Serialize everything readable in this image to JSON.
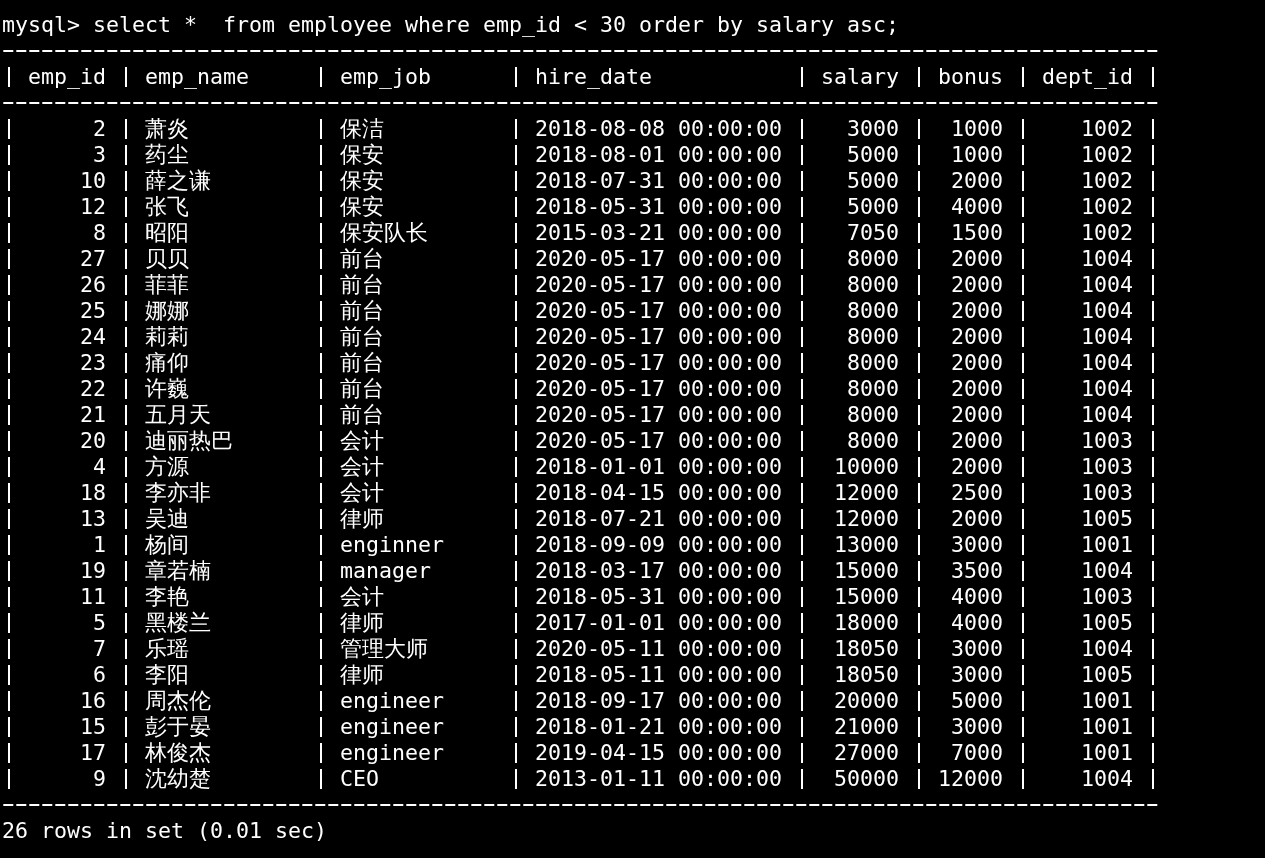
{
  "command": "mysql> select *  from employee where emp_id < 30 order by salary asc;",
  "table": {
    "columns": [
      {
        "label": "emp_id",
        "kind": "number"
      },
      {
        "label": "emp_name",
        "kind": "text"
      },
      {
        "label": "emp_job",
        "kind": "text"
      },
      {
        "label": "hire_date",
        "kind": "text"
      },
      {
        "label": "salary",
        "kind": "number"
      },
      {
        "label": "bonus",
        "kind": "number"
      },
      {
        "label": "dept_id",
        "kind": "number"
      }
    ],
    "rows": [
      [
        "2",
        "萧炎",
        "保洁",
        "2018-08-08 00:00:00",
        "3000",
        "1000",
        "1002"
      ],
      [
        "3",
        "药尘",
        "保安",
        "2018-08-01 00:00:00",
        "5000",
        "1000",
        "1002"
      ],
      [
        "10",
        "薛之谦",
        "保安",
        "2018-07-31 00:00:00",
        "5000",
        "2000",
        "1002"
      ],
      [
        "12",
        "张飞",
        "保安",
        "2018-05-31 00:00:00",
        "5000",
        "4000",
        "1002"
      ],
      [
        "8",
        "昭阳",
        "保安队长",
        "2015-03-21 00:00:00",
        "7050",
        "1500",
        "1002"
      ],
      [
        "27",
        "贝贝",
        "前台",
        "2020-05-17 00:00:00",
        "8000",
        "2000",
        "1004"
      ],
      [
        "26",
        "菲菲",
        "前台",
        "2020-05-17 00:00:00",
        "8000",
        "2000",
        "1004"
      ],
      [
        "25",
        "娜娜",
        "前台",
        "2020-05-17 00:00:00",
        "8000",
        "2000",
        "1004"
      ],
      [
        "24",
        "莉莉",
        "前台",
        "2020-05-17 00:00:00",
        "8000",
        "2000",
        "1004"
      ],
      [
        "23",
        "痛仰",
        "前台",
        "2020-05-17 00:00:00",
        "8000",
        "2000",
        "1004"
      ],
      [
        "22",
        "许巍",
        "前台",
        "2020-05-17 00:00:00",
        "8000",
        "2000",
        "1004"
      ],
      [
        "21",
        "五月天",
        "前台",
        "2020-05-17 00:00:00",
        "8000",
        "2000",
        "1004"
      ],
      [
        "20",
        "迪丽热巴",
        "会计",
        "2020-05-17 00:00:00",
        "8000",
        "2000",
        "1003"
      ],
      [
        "4",
        "方源",
        "会计",
        "2018-01-01 00:00:00",
        "10000",
        "2000",
        "1003"
      ],
      [
        "18",
        "李亦非",
        "会计",
        "2018-04-15 00:00:00",
        "12000",
        "2500",
        "1003"
      ],
      [
        "13",
        "吴迪",
        "律师",
        "2018-07-21 00:00:00",
        "12000",
        "2000",
        "1005"
      ],
      [
        "1",
        "杨间",
        "enginner",
        "2018-09-09 00:00:00",
        "13000",
        "3000",
        "1001"
      ],
      [
        "19",
        "章若楠",
        "manager",
        "2018-03-17 00:00:00",
        "15000",
        "3500",
        "1004"
      ],
      [
        "11",
        "李艳",
        "会计",
        "2018-05-31 00:00:00",
        "15000",
        "4000",
        "1003"
      ],
      [
        "5",
        "黑楼兰",
        "律师",
        "2017-01-01 00:00:00",
        "18000",
        "4000",
        "1005"
      ],
      [
        "7",
        "乐瑶",
        "管理大师",
        "2020-05-11 00:00:00",
        "18050",
        "3000",
        "1004"
      ],
      [
        "6",
        "李阳",
        "律师",
        "2018-05-11 00:00:00",
        "18050",
        "3000",
        "1005"
      ],
      [
        "16",
        "周杰伦",
        "engineer",
        "2018-09-17 00:00:00",
        "20000",
        "5000",
        "1001"
      ],
      [
        "15",
        "彭于晏",
        "engineer",
        "2018-01-21 00:00:00",
        "21000",
        "3000",
        "1001"
      ],
      [
        "17",
        "林俊杰",
        "engineer",
        "2019-04-15 00:00:00",
        "27000",
        "7000",
        "1001"
      ],
      [
        "9",
        "沈幼楚",
        "CEO",
        "2013-01-11 00:00:00",
        "50000",
        "12000",
        "1004"
      ]
    ]
  },
  "result": "26 rows in set (0.01 sec)"
}
